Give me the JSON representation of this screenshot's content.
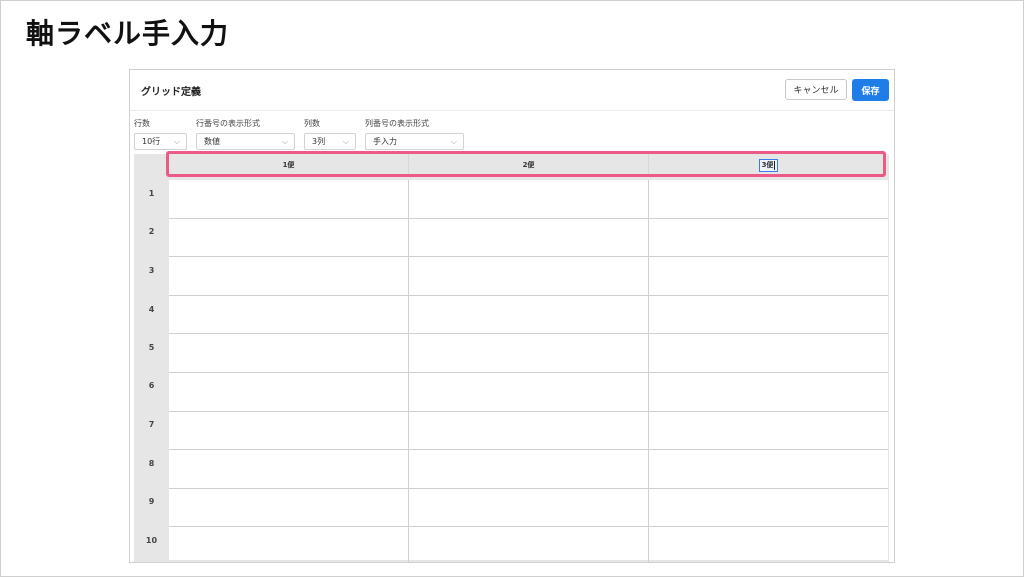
{
  "slide": {
    "title": "軸ラベル手入力"
  },
  "dialog": {
    "title": "グリッド定義",
    "cancel_label": "キャンセル",
    "save_label": "保存"
  },
  "controls": {
    "rows": {
      "label": "行数",
      "value": "10行"
    },
    "row_format": {
      "label": "行番号の表示形式",
      "value": "数値"
    },
    "cols": {
      "label": "列数",
      "value": "3列"
    },
    "col_format": {
      "label": "列番号の表示形式",
      "value": "手入力"
    }
  },
  "grid": {
    "columns": [
      "1便",
      "2便",
      "3便"
    ],
    "rows": [
      "1",
      "2",
      "3",
      "4",
      "5",
      "6",
      "7",
      "8",
      "9",
      "10"
    ],
    "editing_column": 2
  },
  "colors": {
    "accent": "#1f7de8",
    "highlight": "#ec5a86",
    "grid_bg": "#e6e6e6"
  }
}
